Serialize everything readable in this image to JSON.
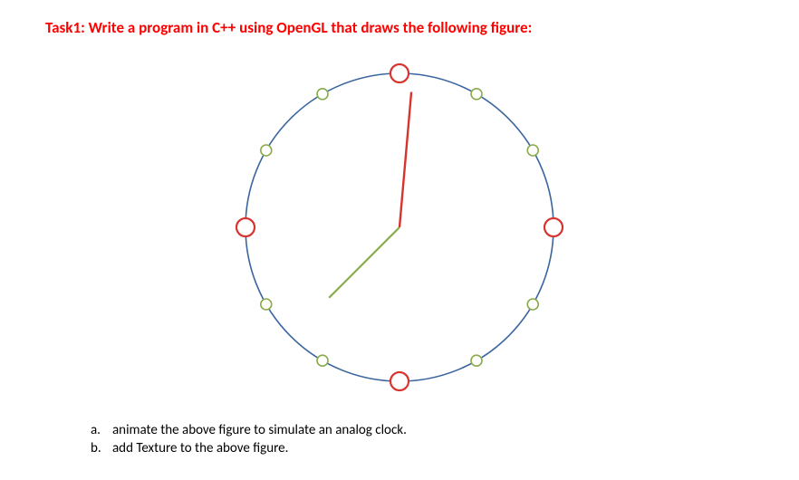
{
  "task": {
    "heading": "Task1: Write a program in C++ using OpenGL that draws the following figure:",
    "subtasks": [
      {
        "letter": "a.",
        "text": "animate the above figure to simulate an analog clock."
      },
      {
        "letter": "b.",
        "text": "add Texture to the above figure."
      }
    ]
  },
  "clock": {
    "circle_stroke": "#3a659e",
    "marker_quarter_stroke": "#d8342f",
    "marker_other_stroke": "#8aac4a",
    "minute_hand_color": "#d8342f",
    "hour_hand_color": "#8aac4a",
    "radius": 170,
    "marker_quarter_radius": 10,
    "marker_other_radius": 6,
    "minute_hand_length": 150,
    "hour_hand_length": 110,
    "minute_hand_angle_deg": 5,
    "hour_hand_angle_deg": 225
  }
}
